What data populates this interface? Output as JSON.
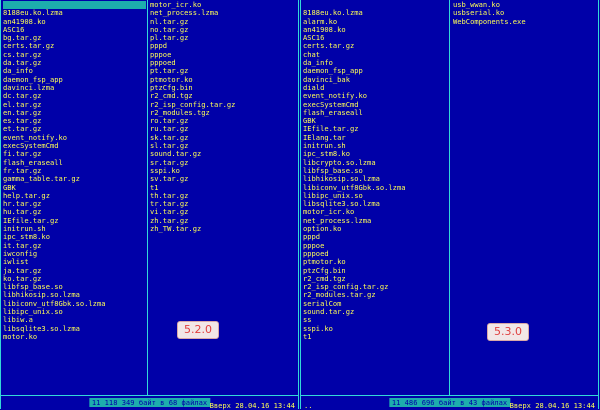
{
  "left_panel": {
    "col1": [
      "",
      "8188eu.ko.lzma",
      "an41908.ko",
      "ASC16",
      "bg.tar.gz",
      "certs.tar.gz",
      "cs.tar.gz",
      "da.tar.gz",
      "da_info",
      "daemon_fsp_app",
      "davinci.lzma",
      "dc.tar.gz",
      "el.tar.gz",
      "en.tar.gz",
      "es.tar.gz",
      "et.tar.gz",
      "event_notify.ko",
      "execSystemCmd",
      "fi.tar.gz",
      "flash_eraseall",
      "fr.tar.gz",
      "gamma_table.tar.gz",
      "GBK",
      "help.tar.gz",
      "hr.tar.gz",
      "hu.tar.gz",
      "IEfile.tar.gz",
      "initrun.sh",
      "ipc_stm8.ko",
      "it.tar.gz",
      "iwconfig",
      "iwlist",
      "ja.tar.gz",
      "ko.tar.gz",
      "libfsp_base.so",
      "libhikosip.so.lzma",
      "libiconv_utf8Gbk.so.lzma",
      "libipc_unix.so",
      "libiw.a",
      "libsqlite3.so.lzma",
      "motor.ko"
    ],
    "col2": [
      "motor_icr.ko",
      "net_process.lzma",
      "nl.tar.gz",
      "no.tar.gz",
      "pl.tar.gz",
      "pppd",
      "pppoe",
      "pppoed",
      "pt.tar.gz",
      "ptmotor.ko",
      "ptzCfg.bin",
      "r2_cmd.tgz",
      "r2_isp_config.tar.gz",
      "r2_modules.tgz",
      "ro.tar.gz",
      "ru.tar.gz",
      "sk.tar.gz",
      "sl.tar.gz",
      "sound.tar.gz",
      "sr.tar.gz",
      "sspi.ko",
      "sv.tar.gz",
      "t1",
      "th.tar.gz",
      "tr.tar.gz",
      "vi.tar.gz",
      "zh.tar.gz",
      "zh_TW.tar.gz"
    ],
    "updir": "",
    "status": "11 118 349 байт в 68 файлах",
    "datetime": "Вверх 28.04.16 13:44",
    "version_badge": "5.2.0"
  },
  "right_panel": {
    "col1": [
      "",
      "8188eu.ko.lzma",
      "alarm.ko",
      "an41908.ko",
      "ASC16",
      "certs.tar.gz",
      "chat",
      "da_info",
      "daemon_fsp_app",
      "davinci_bak",
      "diald",
      "event_notify.ko",
      "execSystemCmd",
      "flash_eraseall",
      "GBK",
      "IEfile.tar.gz",
      "IElang.tar",
      "initrun.sh",
      "ipc_stm8.ko",
      "libcrypto.so.lzma",
      "libfsp_base.so",
      "libhikosip.so.lzma",
      "libiconv_utf8Gbk.so.lzma",
      "libipc_unix.so",
      "libsqlite3.so.lzma",
      "motor_icr.ko",
      "net_process.lzma",
      "option.ko",
      "pppd",
      "pppoe",
      "pppoed",
      "ptmotor.ko",
      "ptzCfg.bin",
      "r2_cmd.tgz",
      "r2_isp_config.tar.gz",
      "r2_modules.tar.gz",
      "serialCom",
      "sound.tar.gz",
      "ss",
      "sspi.ko",
      "t1"
    ],
    "col2": [
      "usb_wwan.ko",
      "usbserial.ko",
      "WebComponents.exe"
    ],
    "updir": "..",
    "status": "11 486 696 байт в 43 файлах",
    "datetime": "Вверх 28.04.16 13:44",
    "version_badge": "5.3.0"
  },
  "colors": {
    "background": "#0000a8",
    "text": "#ffff55",
    "frame": "#33d8d8",
    "cursor": "#1dadad",
    "badge_text": "#e04040"
  }
}
